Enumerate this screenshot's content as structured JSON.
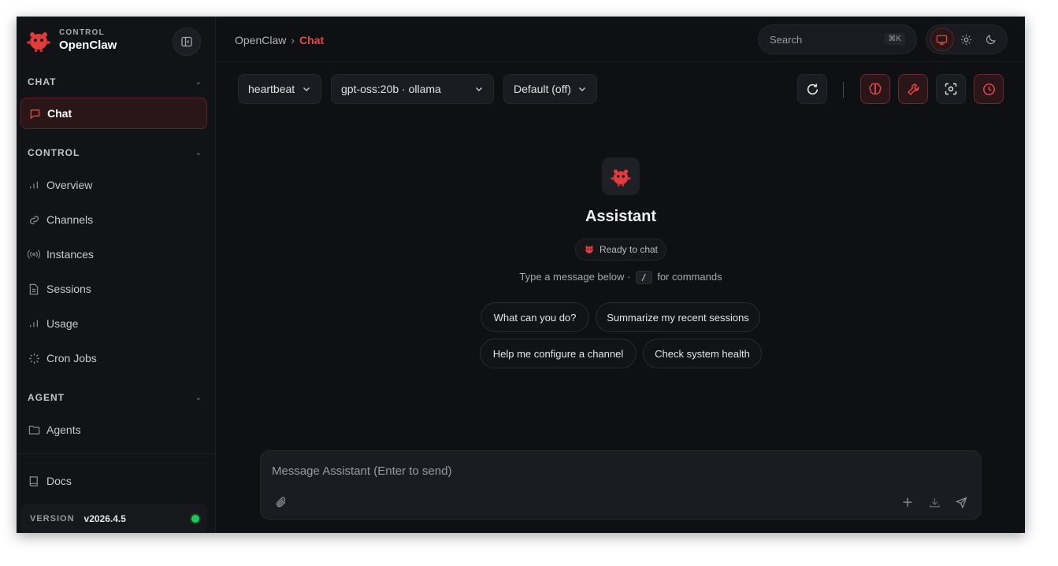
{
  "brand": {
    "sub": "CONTROL",
    "name": "OpenClaw"
  },
  "sidebar": {
    "sections": [
      {
        "title": "CHAT"
      },
      {
        "title": "CONTROL"
      },
      {
        "title": "AGENT"
      }
    ],
    "items": {
      "chat": "Chat",
      "overview": "Overview",
      "channels": "Channels",
      "instances": "Instances",
      "sessions": "Sessions",
      "usage": "Usage",
      "cron": "Cron Jobs",
      "agents": "Agents",
      "docs": "Docs"
    },
    "version_label": "VERSION",
    "version_value": "v2026.4.5",
    "status_color": "#22c55e"
  },
  "topbar": {
    "crumb_root": "OpenClaw",
    "crumb_sep": "›",
    "crumb_current": "Chat",
    "search_placeholder": "Search",
    "search_shortcut": "⌘K"
  },
  "toolbar": {
    "session_select": "heartbeat",
    "model_select": "gpt-oss:20b · ollama",
    "thinking_select": "Default (off)"
  },
  "main": {
    "title": "Assistant",
    "status": "Ready to chat",
    "hint_before": "Type a message below ·",
    "hint_key": "/",
    "hint_after": "for commands",
    "suggestions": [
      "What can you do?",
      "Summarize my recent sessions",
      "Help me configure a channel",
      "Check system health"
    ]
  },
  "composer": {
    "placeholder": "Message Assistant (Enter to send)"
  },
  "colors": {
    "accent": "#ef4444",
    "background": "#0f1014"
  }
}
